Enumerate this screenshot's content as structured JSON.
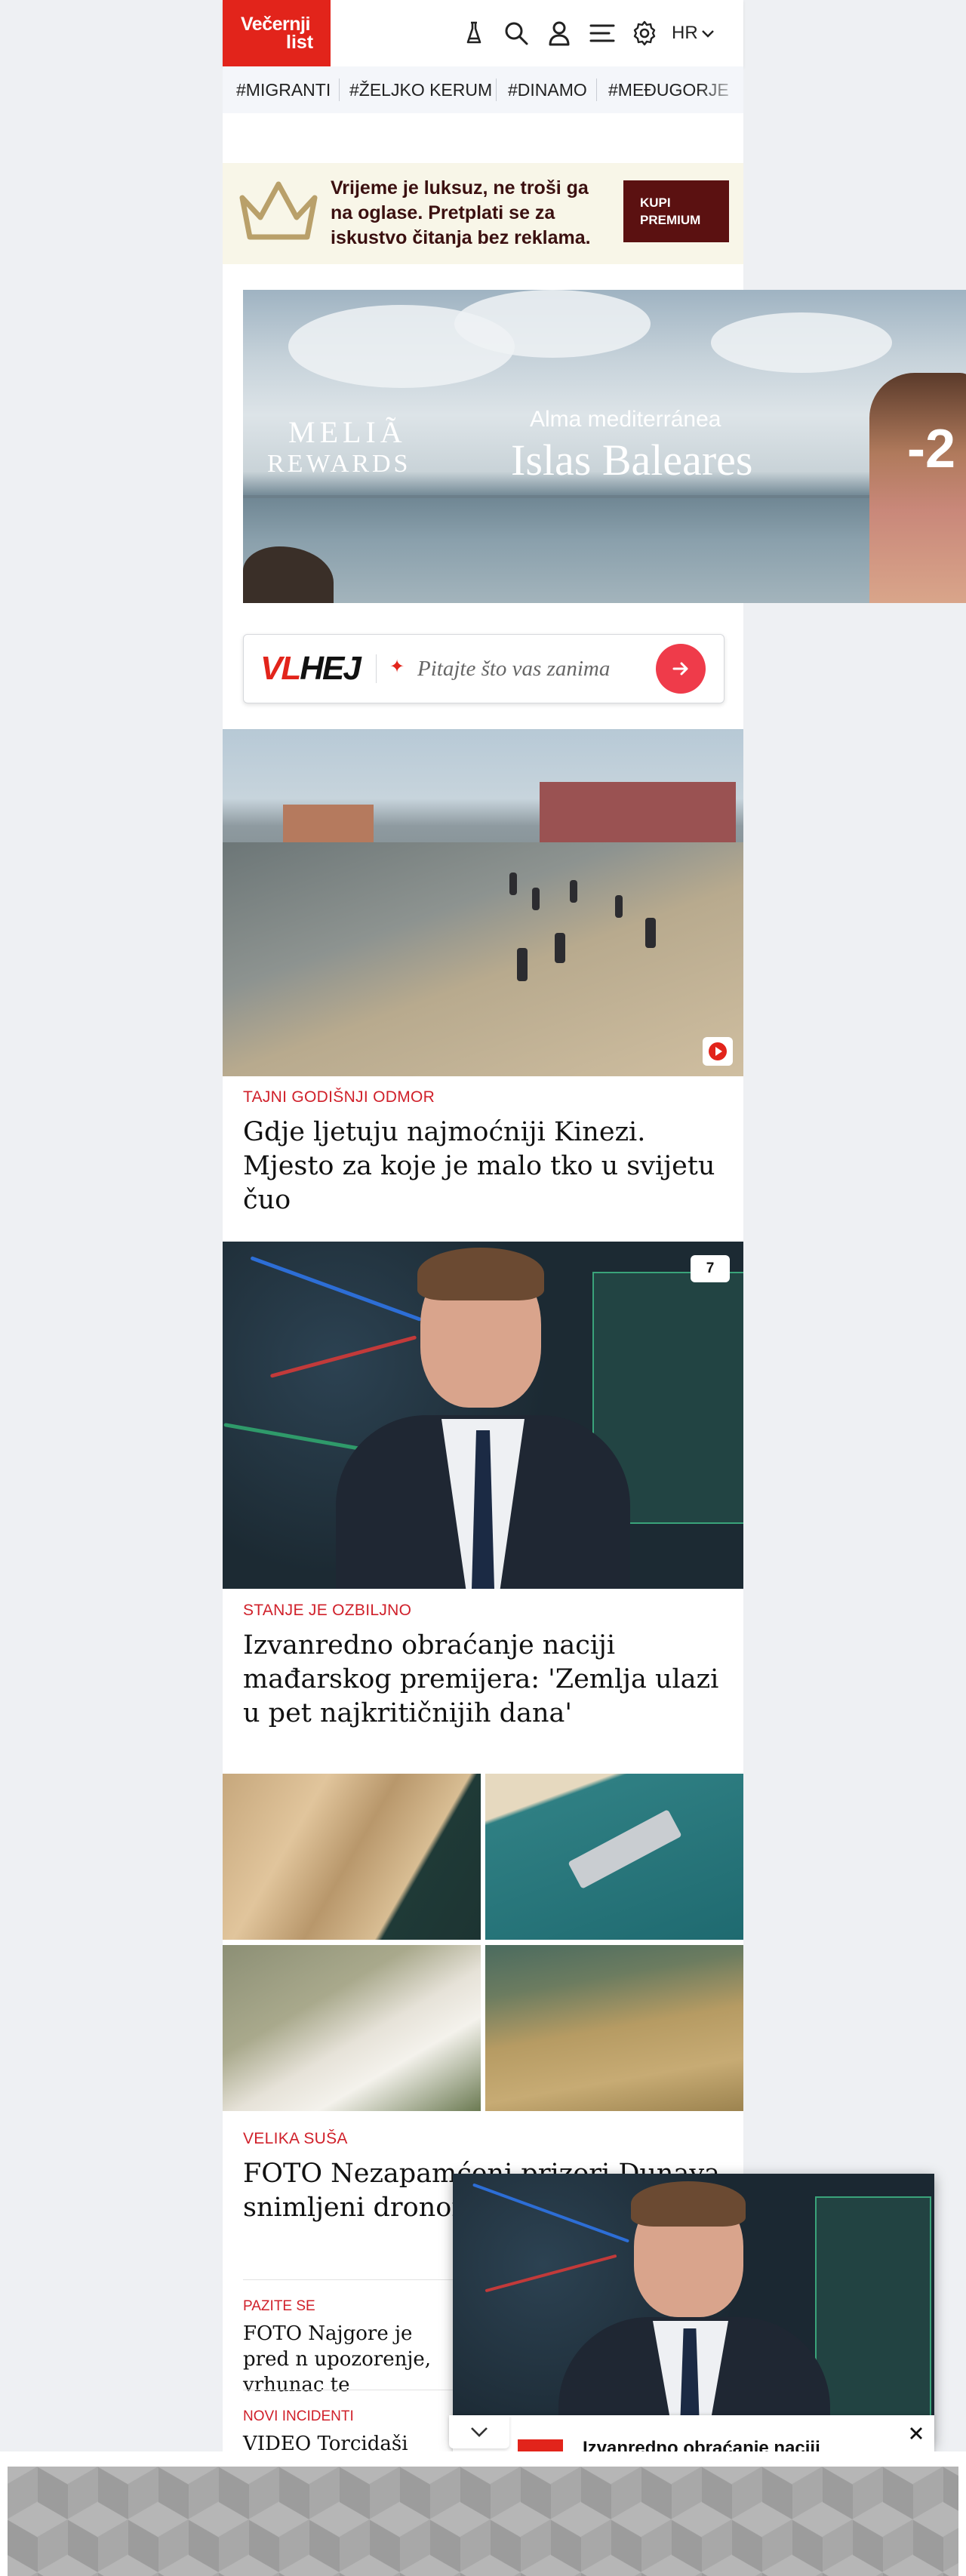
{
  "header": {
    "logo_line1": "Večernji",
    "logo_line2": "list",
    "language": "HR"
  },
  "tags": [
    "#MIGRANTI",
    "#ŽELJKO KERUM",
    "#DINAMO",
    "#MEĐUGORJE"
  ],
  "premium": {
    "text": "Vrijeme je luksuz, ne troši ga na oglase. Pretplati se za iskustvo čitanja bez reklama.",
    "button_line1": "KUPI",
    "button_line2": "PREMIUM"
  },
  "ad": {
    "brand_line1": "MELIÃ",
    "brand_line2": "REWARDS",
    "subtitle": "Alma mediterránea",
    "title": "Islas Baleares",
    "badge": "-2"
  },
  "vlhej": {
    "logo_vl": "VL",
    "logo_hej": "HEJ",
    "placeholder": "Pitajte što vas zanima"
  },
  "articles": [
    {
      "kicker": "TAJNI GODIŠNJI ODMOR",
      "headline": "Gdje ljetuju najmoćniji Kinezi. Mjesto za koje je malo tko u svijetu čuo"
    },
    {
      "kicker": "STANJE JE OZBILJNO",
      "headline": "Izvanredno obraćanje naciji mađarskog premijera: 'Zemlja ulazi u pet najkritičnijih dana'",
      "comments": "7"
    },
    {
      "kicker": "VELIKA SUŠA",
      "headline": "FOTO Nezapamćeni prizori Dunava snimljeni dronom je zabrinjavajuć"
    }
  ],
  "small_articles": [
    {
      "kicker": "PAZITE SE",
      "headline": "FOTO Najgore je pred n upozorenje, vrhunac te"
    },
    {
      "kicker": "NOVI INCIDENTI",
      "headline": "VIDEO Torcidaši zapa"
    }
  ],
  "floating_video": {
    "title": "Izvanredno obraćanje naciji"
  }
}
